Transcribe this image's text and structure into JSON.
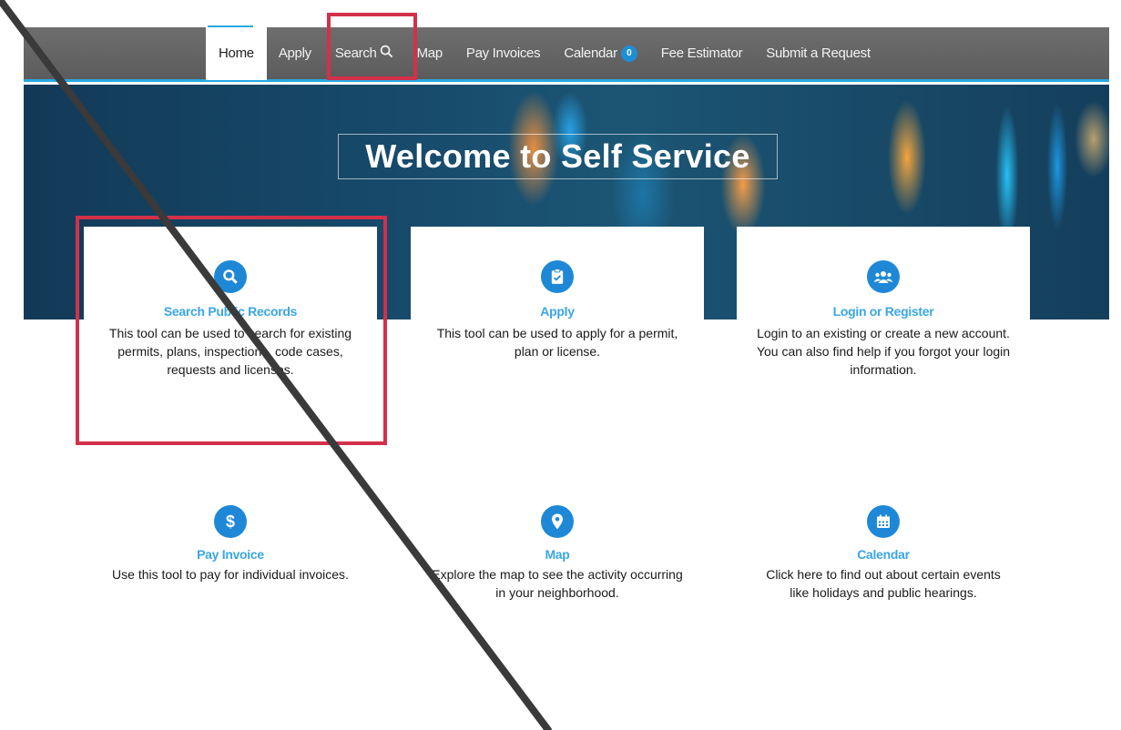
{
  "nav": {
    "items": [
      {
        "label": "Home"
      },
      {
        "label": "Apply"
      },
      {
        "label": "Search"
      },
      {
        "label": "Map"
      },
      {
        "label": "Pay Invoices"
      },
      {
        "label": "Calendar"
      },
      {
        "label": "Fee Estimator"
      },
      {
        "label": "Submit a Request"
      }
    ],
    "calendar_badge": "0",
    "search_icon": "magnifier-icon"
  },
  "hero": {
    "title": "Welcome to Self Service"
  },
  "cards": [
    {
      "icon": "search-icon",
      "title": "Search Public Records",
      "desc": "This tool can be used to search for existing permits, plans, inspections, code cases, requests and licenses."
    },
    {
      "icon": "clipboard-icon",
      "title": "Apply",
      "desc": "This tool can be used to apply for a permit, plan or license."
    },
    {
      "icon": "users-icon",
      "title": "Login or Register",
      "desc": "Login to an existing or create a new account. You can also find help if you forgot your login information."
    }
  ],
  "tiles": [
    {
      "icon": "dollar-icon",
      "title": "Pay Invoice",
      "desc": "Use this tool to pay for individual invoices."
    },
    {
      "icon": "map-pin-icon",
      "title": "Map",
      "desc": "Explore the map to see the activity occurring in your neighborhood."
    },
    {
      "icon": "calendar-icon",
      "title": "Calendar",
      "desc": "Click here to find out about certain events like holidays and public hearings."
    }
  ],
  "colors": {
    "nav_bg": "#636363",
    "accent": "#29a8e0",
    "icon_blue": "#1e88d6",
    "title_blue": "#3aa6e3",
    "highlight_red": "#d3304a"
  }
}
